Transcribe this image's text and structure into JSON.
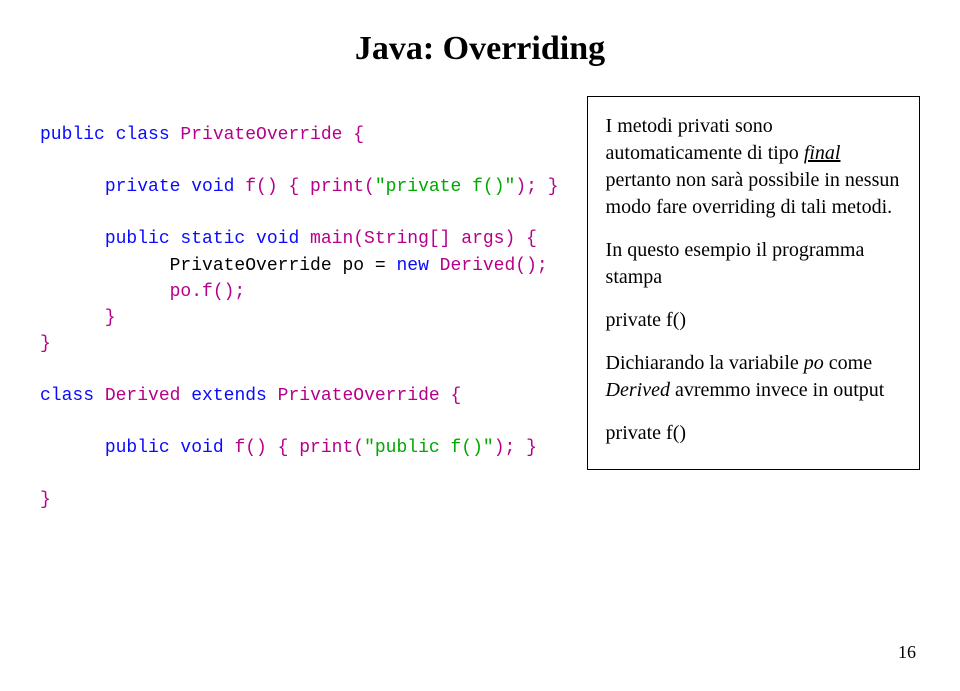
{
  "title": "Java: Overriding",
  "code": {
    "classDecl": {
      "kw1": "public class",
      "name": " PrivateOverride {"
    },
    "privMethod": {
      "kw": "private void",
      "name": " f() { print(",
      "str": "\"private f()\"",
      "tail": "); }"
    },
    "mainDecl": {
      "kw": "public static void",
      "name": " main(String[] args) {"
    },
    "newObj": {
      "indent": "            PrivateOverride po = ",
      "kw": "new",
      "name": " Derived();"
    },
    "call": "            po.f();",
    "close1": "      }",
    "close2": "}",
    "derivedDecl": {
      "kw": "class",
      "name1": " Derived ",
      "kw2": "extends",
      "name2": " PrivateOverride {"
    },
    "pubMethod": {
      "kw": "public void",
      "name": " f() { print(",
      "str": "\"public f()\"",
      "tail": "); }"
    },
    "close3": "}"
  },
  "info": {
    "p1a": "I metodi privati sono automaticamente di tipo ",
    "p1final": "final",
    "p1b": " pertanto non sarà possibile in nessun modo fare overriding di tali metodi.",
    "p2": "In questo esempio il programma stampa",
    "p3": "private f()",
    "p4a": "Dichiarando la variabile ",
    "p4po": "po",
    "p4b": " come ",
    "p4der": "Derived",
    "p4c": " avremmo invece in output",
    "p5": "private f()"
  },
  "pageNum": "16"
}
